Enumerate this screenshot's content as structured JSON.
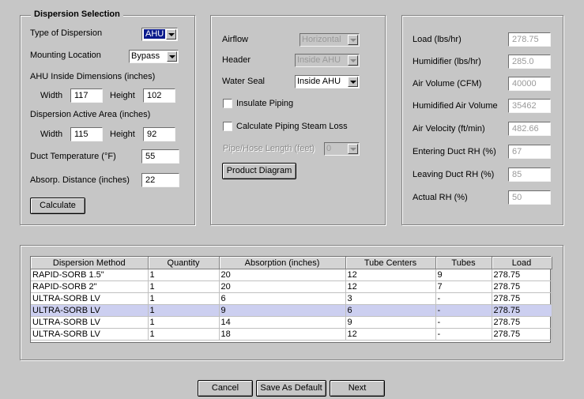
{
  "dispersion": {
    "legend": "Dispersion Selection",
    "type_label": "Type of Dispersion",
    "type_value": "AHU",
    "mounting_label": "Mounting Location",
    "mounting_value": "Bypass",
    "ahu_dims_label": "AHU Inside Dimensions (inches)",
    "width_label": "Width",
    "ahu_width": "117",
    "height_label": "Height",
    "ahu_height": "102",
    "active_area_label": "Dispersion Active Area (inches)",
    "active_width": "115",
    "active_height": "92",
    "duct_temp_label": "Duct Temperature (°F)",
    "duct_temp": "55",
    "absorp_label": "Absorp. Distance (inches)",
    "absorp": "22",
    "calculate_label": "Calculate"
  },
  "piping": {
    "airflow_label": "Airflow",
    "airflow_value": "Horizontal",
    "header_label": "Header",
    "header_value": "Inside AHU",
    "water_seal_label": "Water Seal",
    "water_seal_value": "Inside AHU",
    "insulate_label": "Insulate Piping",
    "calc_loss_label": "Calculate Piping Steam Loss",
    "pipe_length_label": "Pipe/Hose Length (feet)",
    "pipe_length_value": "0",
    "product_diagram_label": "Product Diagram"
  },
  "results": {
    "load_label": "Load (lbs/hr)",
    "load": "278.75",
    "humidifier_label": "Humidifier (lbs/hr)",
    "humidifier": "285.0",
    "air_volume_label": "Air Volume (CFM)",
    "air_volume": "40000",
    "humidified_label": "Humidified Air Volume",
    "humidified": "35462",
    "velocity_label": "Air Velocity (ft/min)",
    "velocity": "482.66",
    "entering_label": "Entering Duct RH (%)",
    "entering": "67",
    "leaving_label": "Leaving Duct RH (%)",
    "leaving": "85",
    "actual_label": "Actual RH (%)",
    "actual": "50"
  },
  "table": {
    "headers": [
      "Dispersion Method",
      "Quantity",
      "Absorption (inches)",
      "Tube Centers",
      "Tubes",
      "Load"
    ],
    "rows": [
      [
        "RAPID-SORB 1.5\"",
        "1",
        "20",
        "12",
        "9",
        "278.75"
      ],
      [
        "RAPID-SORB 2\"",
        "1",
        "20",
        "12",
        "7",
        "278.75"
      ],
      [
        "ULTRA-SORB LV",
        "1",
        "6",
        "3",
        "-",
        "278.75"
      ],
      [
        "ULTRA-SORB LV",
        "1",
        "9",
        "6",
        "-",
        "278.75"
      ],
      [
        "ULTRA-SORB LV",
        "1",
        "14",
        "9",
        "-",
        "278.75"
      ],
      [
        "ULTRA-SORB LV",
        "1",
        "18",
        "12",
        "-",
        "278.75"
      ]
    ],
    "selected_row": 3
  },
  "footer": {
    "cancel_label": "Cancel",
    "save_default_label": "Save As Default",
    "next_label": "Next"
  }
}
